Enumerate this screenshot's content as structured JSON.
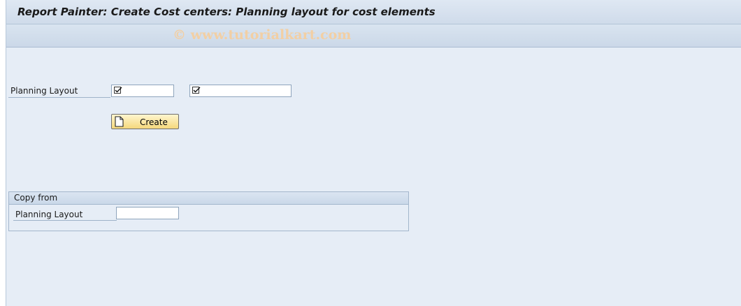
{
  "title": "Report Painter: Create Cost centers: Planning layout for cost elements",
  "watermark": "© www.tutorialkart.com",
  "main": {
    "planning_layout_label": "Planning Layout",
    "field1_value": "",
    "field2_value": "",
    "create_button_label": "Create"
  },
  "copy_from": {
    "group_title": "Copy from",
    "planning_layout_label": "Planning Layout",
    "field_value": ""
  },
  "icons": {
    "required_field": "checkbox-check-icon",
    "create": "document-icon"
  }
}
